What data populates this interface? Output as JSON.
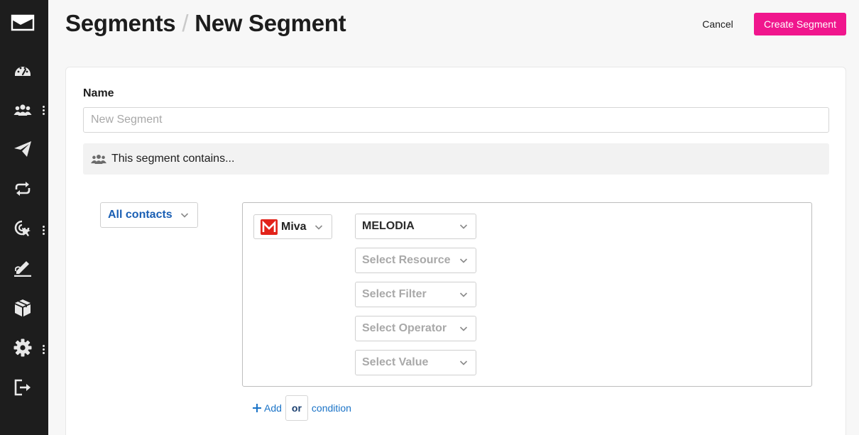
{
  "header": {
    "breadcrumb_parent": "Segments",
    "breadcrumb_separator": "/",
    "breadcrumb_current": "New Segment",
    "cancel_label": "Cancel",
    "create_label": "Create Segment"
  },
  "sidebar": {
    "items": [
      {
        "icon": "dashboard-gauge-icon",
        "has_more": false
      },
      {
        "icon": "contacts-group-icon",
        "has_more": true
      },
      {
        "icon": "campaign-send-icon",
        "has_more": false
      },
      {
        "icon": "automation-loop-icon",
        "has_more": false
      },
      {
        "icon": "tracking-cursor-icon",
        "has_more": true
      },
      {
        "icon": "signup-forms-icon",
        "has_more": false
      },
      {
        "icon": "products-box-icon",
        "has_more": false
      },
      {
        "icon": "settings-gear-icon",
        "has_more": true
      },
      {
        "icon": "logout-icon",
        "has_more": false
      }
    ]
  },
  "form": {
    "name_label": "Name",
    "name_placeholder": "New Segment",
    "name_value": "",
    "contains_text": "This segment contains..."
  },
  "segment": {
    "scope_label": "All contacts",
    "integration_label": "Miva",
    "store_value": "MELODIA",
    "resource_placeholder": "Select Resource",
    "filter_placeholder": "Select Filter",
    "operator_placeholder": "Select Operator",
    "value_placeholder": "Select Value"
  },
  "add_condition": {
    "add_label": "Add",
    "or_label": "or",
    "condition_label": "condition"
  },
  "colors": {
    "sidebar_bg": "#1d1d1d",
    "accent_pink": "#f0168d",
    "link_blue": "#1a73c7",
    "miva_red": "#e2231a"
  }
}
